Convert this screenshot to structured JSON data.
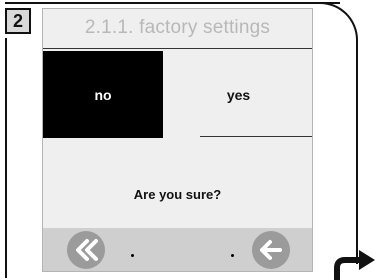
{
  "step_number": "2",
  "screen": {
    "title": "2.1.1. factory settings",
    "options": {
      "no_label": "no",
      "yes_label": "yes",
      "selected": "no"
    },
    "question": "Are you sure?",
    "bottom_bar": {
      "left_button_icon": "double-chevron-left-icon",
      "right_button_icon": "arrow-left-icon",
      "dots": [
        ".",
        "."
      ]
    }
  },
  "colors": {
    "screen_bg": "#efefef",
    "selected_bg": "#000000",
    "title_text": "#b8b8b8",
    "bottom_bar_bg": "#cfcfcf",
    "button_bg": "#9b9b9b"
  },
  "hint_icon": "turn-right-arrow-icon"
}
